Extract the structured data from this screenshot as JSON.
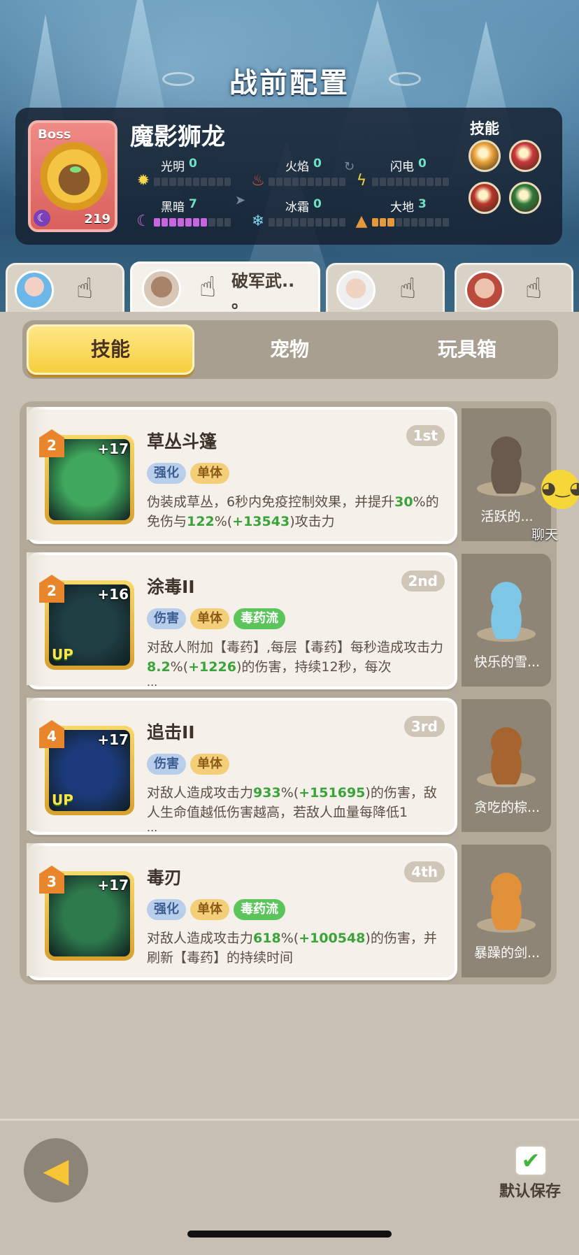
{
  "header": {
    "title": "战前配置"
  },
  "boss": {
    "tag": "Boss",
    "name": "魔影狮龙",
    "level": "219",
    "skills_label": "技能",
    "elements": [
      {
        "name": "光明",
        "value": "0",
        "filled": 0
      },
      {
        "name": "火焰",
        "value": "0",
        "filled": 0
      },
      {
        "name": "闪电",
        "value": "0",
        "filled": 0
      },
      {
        "name": "黑暗",
        "value": "7",
        "filled": 7
      },
      {
        "name": "冰霜",
        "value": "0",
        "filled": 0
      },
      {
        "name": "大地",
        "value": "3",
        "filled": 3
      }
    ],
    "skill_colors": [
      "#e9a23a",
      "#c9383a",
      "#b8362a",
      "#2f7a3a"
    ]
  },
  "heroes": [
    {
      "name": "",
      "active": false
    },
    {
      "name": "破军武..\n。",
      "active": true
    },
    {
      "name": "",
      "active": false
    },
    {
      "name": "",
      "active": false
    }
  ],
  "subtabs": [
    {
      "label": "技能",
      "active": true
    },
    {
      "label": "宠物",
      "active": false
    },
    {
      "label": "玩具箱",
      "active": false
    }
  ],
  "skills": [
    {
      "name": "草丛斗篷",
      "rank": "1st",
      "level": "2",
      "plus": "+17",
      "up": "",
      "tags": [
        {
          "t": "强化",
          "c": "blue"
        },
        {
          "t": "单体",
          "c": "orange"
        }
      ],
      "desc_parts": [
        "伪装成草丛，6秒内免疫控制效果，并提升",
        "30",
        "%的免伤与",
        "122",
        "%(",
        "+13543",
        ")攻击力"
      ],
      "ellipsis": "",
      "icon_color": "#3fa85c"
    },
    {
      "name": "涂毒II",
      "rank": "2nd",
      "level": "2",
      "plus": "+16",
      "up": "UP",
      "tags": [
        {
          "t": "伤害",
          "c": "blue"
        },
        {
          "t": "单体",
          "c": "orange"
        },
        {
          "t": "毒药流",
          "c": "green"
        }
      ],
      "desc_parts": [
        "对敌人附加【毒药】,每层【毒药】每秒造成攻击力",
        "8.2",
        "%(",
        "+1226",
        ")的伤害，持续12秒，每次"
      ],
      "ellipsis": "...",
      "icon_color": "#1f3f44"
    },
    {
      "name": "追击II",
      "rank": "3rd",
      "level": "4",
      "plus": "+17",
      "up": "UP",
      "tags": [
        {
          "t": "伤害",
          "c": "blue"
        },
        {
          "t": "单体",
          "c": "orange"
        }
      ],
      "desc_parts": [
        "对敌人造成攻击力",
        "933",
        "%(",
        "+151695",
        ")的伤害，敌人生命值越低伤害越高，若敌人血量每降低1"
      ],
      "ellipsis": "...",
      "icon_color": "#1c3a7a"
    },
    {
      "name": "毒刃",
      "rank": "4th",
      "level": "3",
      "plus": "+17",
      "up": "",
      "tags": [
        {
          "t": "强化",
          "c": "blue"
        },
        {
          "t": "单体",
          "c": "orange"
        },
        {
          "t": "毒药流",
          "c": "green"
        }
      ],
      "desc_parts": [
        "对敌人造成攻击力",
        "618",
        "%(",
        "+100548",
        ")的伤害，并刷新【毒药】的持续时间"
      ],
      "ellipsis": "",
      "icon_color": "#2f7a4c"
    }
  ],
  "pets": [
    {
      "name": "活跃的...",
      "color": "#6a5a4e"
    },
    {
      "name": "快乐的雪...",
      "color": "#7ec7e6"
    },
    {
      "name": "贪吃的棕...",
      "color": "#a6642e"
    },
    {
      "name": "暴躁的剑...",
      "color": "#e1913a"
    }
  ],
  "chat": {
    "label": "聊天"
  },
  "footer": {
    "save_label": "默认保存"
  }
}
